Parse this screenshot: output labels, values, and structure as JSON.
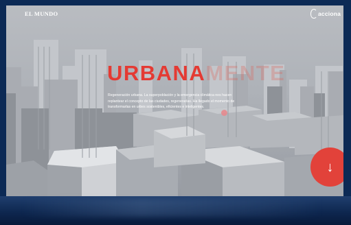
{
  "header": {
    "left_logo": "EL MUNDO",
    "right_logo": "acciona"
  },
  "side_text": "",
  "hero": {
    "title_bold": "URBANA",
    "title_ghost": "MENTE",
    "intro": "Regeneración urbana. La superpoblación y la emergencia climática nos hacen replantear el concepto de las ciudades, regenerarlas. Ha llegado el momento de transformarlas en urbes sostenibles, eficientes e inteligentes."
  },
  "scroll_button": {
    "icon": "arrow-down-icon",
    "glyph": "↓"
  },
  "colors": {
    "accent": "#e43a33",
    "background": "#0c2a55",
    "sky": "#b9bcc1"
  }
}
